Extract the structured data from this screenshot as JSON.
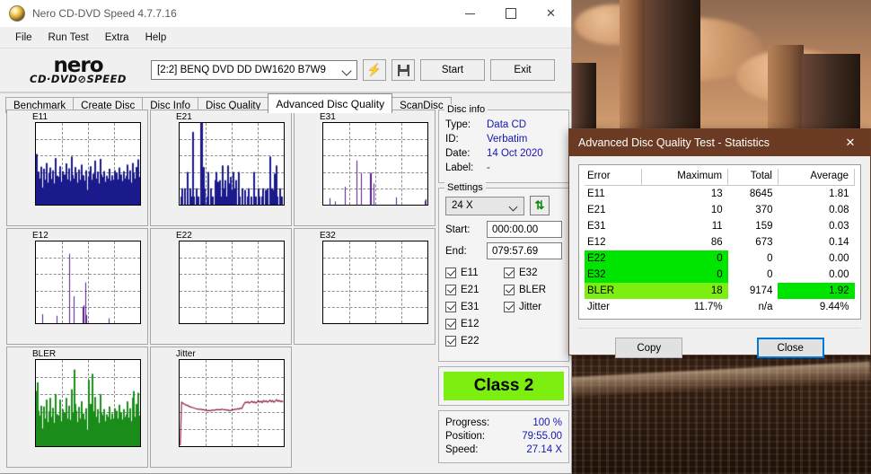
{
  "window": {
    "title": "Nero CD-DVD Speed 4.7.7.16",
    "minimize": "─",
    "maximize": "☐",
    "close": "✕"
  },
  "menu": [
    "File",
    "Run Test",
    "Extra",
    "Help"
  ],
  "toolbar": {
    "logo_line1": "nero",
    "logo_line2": "CD·DVD⊘SPEED",
    "drive": "[2:2]   BENQ DVD DD DW1620 B7W9",
    "bolt_icon": "lightning-icon",
    "save_icon": "floppy-save-icon",
    "start_label": "Start",
    "exit_label": "Exit"
  },
  "tabs": [
    {
      "label": "Benchmark",
      "active": false
    },
    {
      "label": "Create Disc",
      "active": false
    },
    {
      "label": "Disc Info",
      "active": false
    },
    {
      "label": "Disc Quality",
      "active": false
    },
    {
      "label": "Advanced Disc Quality",
      "active": true
    },
    {
      "label": "ScanDisc",
      "active": false
    }
  ],
  "disc_info": {
    "legend": "Disc info",
    "rows": [
      {
        "key": "Type:",
        "value": "Data CD"
      },
      {
        "key": "ID:",
        "value": "Verbatim"
      },
      {
        "key": "Date:",
        "value": "14 Oct 2020"
      },
      {
        "key": "Label:",
        "value": "-"
      }
    ]
  },
  "settings": {
    "legend": "Settings",
    "speed": "24 X",
    "refresh_icon": "refresh-icon",
    "start_label": "Start:",
    "start_value": "000:00.00",
    "end_label": "End:",
    "end_value": "079:57.69",
    "checkboxes_left": [
      {
        "label": "E11",
        "checked": true
      },
      {
        "label": "E21",
        "checked": true
      },
      {
        "label": "E31",
        "checked": true
      },
      {
        "label": "E12",
        "checked": true
      },
      {
        "label": "E22",
        "checked": true
      }
    ],
    "checkboxes_right": [
      {
        "label": "E32",
        "checked": true
      },
      {
        "label": "BLER",
        "checked": true
      },
      {
        "label": "Jitter",
        "checked": true
      }
    ]
  },
  "class_box": {
    "label": "Class 2",
    "color": "#7CEE10"
  },
  "progress_panel": [
    {
      "key": "Progress:",
      "value": "100 %"
    },
    {
      "key": "Position:",
      "value": "79:55.00"
    },
    {
      "key": "Speed:",
      "value": "27.14 X"
    }
  ],
  "statistics_dialog": {
    "title": "Advanced Disc Quality Test - Statistics",
    "close_icon": "✕",
    "headers": [
      "Error",
      "Maximum",
      "Total",
      "Average"
    ],
    "rows": [
      {
        "error": "E11",
        "maximum": "13",
        "total": "8645",
        "average": "1.81",
        "hl": "none"
      },
      {
        "error": "E21",
        "maximum": "10",
        "total": "370",
        "average": "0.08",
        "hl": "none"
      },
      {
        "error": "E31",
        "maximum": "11",
        "total": "159",
        "average": "0.03",
        "hl": "none"
      },
      {
        "error": "E12",
        "maximum": "86",
        "total": "673",
        "average": "0.14",
        "hl": "none"
      },
      {
        "error": "E22",
        "maximum": "0",
        "total": "0",
        "average": "0.00",
        "hl": "green"
      },
      {
        "error": "E32",
        "maximum": "0",
        "total": "0",
        "average": "0.00",
        "hl": "green"
      },
      {
        "error": "BLER",
        "maximum": "18",
        "total": "9174",
        "average": "1.92",
        "hl": "bler"
      },
      {
        "error": "Jitter",
        "maximum": "11.7%",
        "total": "n/a",
        "average": "9.44%",
        "hl": "none"
      }
    ],
    "copy_label": "Copy",
    "close_label": "Close",
    "title_bar_color": "#6b3a23",
    "green": "#00E500",
    "bler_green": "#7CEE10"
  },
  "chart_data": [
    {
      "type": "bar",
      "title": "E11",
      "xlabel": "",
      "ylabel": "",
      "xlim": [
        0,
        80
      ],
      "ylim": [
        0,
        20
      ],
      "xticks": [
        0,
        20,
        40,
        60,
        80
      ],
      "yticks": [
        4,
        8,
        12,
        16,
        20
      ],
      "color": "#1a1a8c",
      "grid": true,
      "fill": true,
      "values": [
        12.4,
        7.2,
        8.1,
        6.4,
        9.3,
        4.2,
        8.8,
        6.1,
        10.2,
        5.4,
        7.8,
        9.1,
        6.3,
        8.4,
        5.2,
        11.4,
        7.1,
        6.8,
        9.4,
        5.6,
        8.2,
        6.9,
        7.4,
        10.1,
        6.2,
        8.9,
        5.8,
        11.8,
        7.3,
        6.4,
        9.2,
        7.8,
        5.4,
        8.6,
        6.1,
        9.8,
        7.2,
        5.9,
        8.4,
        3.6,
        6.8,
        8.2,
        9.4,
        6.1,
        7.6,
        10.8,
        6.4,
        8.1,
        5.2,
        11.2,
        7.4,
        6.8,
        8.2,
        5.6,
        7.1,
        6.4,
        8.8,
        5.9,
        7.2,
        6.1,
        8.4,
        5.4,
        7.8,
        6.2,
        9.1,
        7.4,
        5.8,
        8.2,
        6.4,
        7.1,
        9.8,
        6.2,
        8.4,
        5.4,
        10.2,
        7.8,
        6.4,
        9.2,
        11.1,
        6.8
      ]
    },
    {
      "type": "bar",
      "title": "E21",
      "xlabel": "",
      "ylabel": "",
      "xlim": [
        0,
        80
      ],
      "ylim": [
        0,
        10
      ],
      "xticks": [
        0,
        20,
        40,
        60,
        80
      ],
      "yticks": [
        2,
        4,
        6,
        8,
        10
      ],
      "color": "#1a1a8c",
      "grid": true,
      "fill": true,
      "values": [
        0,
        1,
        2,
        0,
        2,
        0,
        4,
        0,
        2,
        1,
        8.9,
        1,
        0,
        2,
        1,
        0,
        10,
        10,
        4.6,
        2,
        0,
        1,
        4,
        0,
        2,
        1,
        0,
        3,
        4,
        2.8,
        0,
        3,
        1,
        4.8,
        2,
        3,
        1,
        4.8,
        2.6,
        3.4,
        1.8,
        4,
        2,
        3,
        0,
        4,
        1,
        0,
        2,
        0,
        1.8,
        0,
        1,
        2,
        0,
        1,
        0,
        4,
        1,
        0,
        2,
        1,
        0,
        1,
        2,
        0,
        1.8,
        2,
        0,
        5.9,
        1,
        2,
        1.8,
        3.8,
        4.8,
        1,
        0,
        2,
        1,
        0
      ]
    },
    {
      "type": "bar",
      "title": "E31",
      "xlabel": "",
      "ylabel": "",
      "xlim": [
        0,
        80
      ],
      "ylim": [
        0,
        20
      ],
      "xticks": [
        0,
        20,
        40,
        60,
        80
      ],
      "yticks": [
        4,
        8,
        12,
        16,
        20
      ],
      "color": "#5a1a8c",
      "grid": true,
      "fill": false,
      "values": [
        0,
        0,
        0,
        0,
        0,
        1.6,
        0,
        0,
        0,
        0.8,
        0,
        0,
        0,
        0,
        0,
        0,
        0,
        4.4,
        0,
        0,
        0,
        0,
        0,
        0,
        0,
        0,
        10.8,
        0,
        0,
        7.8,
        0,
        0,
        0,
        0,
        0,
        0,
        7.8,
        7.8,
        0,
        5.2,
        0,
        0,
        0,
        0,
        0,
        0,
        0,
        0,
        0,
        0,
        0,
        0,
        0,
        0,
        0,
        0,
        1.8,
        0,
        0,
        0,
        0,
        0,
        0,
        0,
        0,
        0,
        0,
        0,
        0,
        0,
        0,
        0,
        0,
        0,
        0,
        0,
        0,
        0,
        1,
        1.4
      ]
    },
    {
      "type": "bar",
      "title": "E12",
      "xlabel": "",
      "ylabel": "",
      "xlim": [
        0,
        80
      ],
      "ylim": [
        0,
        100
      ],
      "xticks": [
        0,
        20,
        40,
        60,
        80
      ],
      "yticks": [
        20,
        40,
        60,
        80,
        100
      ],
      "color": "#5a1a8c",
      "grid": true,
      "fill": false,
      "values": [
        0,
        0,
        0,
        0,
        0,
        11,
        0,
        0,
        0,
        0,
        0,
        0,
        0,
        0,
        0,
        0,
        9,
        0,
        0,
        0,
        0,
        0,
        0,
        0,
        0,
        0,
        85,
        0,
        0,
        33,
        0,
        0,
        0,
        0,
        0,
        0,
        20,
        22,
        50,
        10,
        0,
        0,
        0,
        0,
        0,
        0,
        0,
        0,
        0,
        0,
        0,
        0,
        0,
        0,
        0,
        0,
        6,
        0,
        0,
        0,
        0,
        0,
        0,
        0,
        0,
        0,
        0,
        0,
        0,
        0,
        0,
        0,
        0,
        0,
        0,
        0,
        0,
        0,
        0,
        0
      ]
    },
    {
      "type": "bar",
      "title": "E22",
      "xlabel": "",
      "ylabel": "",
      "xlim": [
        0,
        80
      ],
      "ylim": [
        0,
        10
      ],
      "xticks": [
        0,
        20,
        40,
        60,
        80
      ],
      "yticks": [
        2,
        4,
        6,
        8,
        10
      ],
      "color": "#5a1a8c",
      "grid": true,
      "fill": false,
      "values": []
    },
    {
      "type": "bar",
      "title": "E32",
      "xlabel": "",
      "ylabel": "",
      "xlim": [
        0,
        80
      ],
      "ylim": [
        0,
        10
      ],
      "xticks": [
        0,
        20,
        40,
        60,
        80
      ],
      "yticks": [
        2,
        4,
        6,
        8,
        10
      ],
      "color": "#5a1a8c",
      "grid": true,
      "fill": false,
      "values": []
    },
    {
      "type": "bar",
      "title": "BLER",
      "xlabel": "",
      "ylabel": "",
      "xlim": [
        0,
        80
      ],
      "ylim": [
        0,
        20
      ],
      "xticks": [
        0,
        20,
        40,
        60,
        80
      ],
      "yticks": [
        4,
        8,
        12,
        16,
        20
      ],
      "color": "#1a8c1a",
      "grid": true,
      "fill": true,
      "values": [
        12.8,
        14.8,
        8.2,
        7.1,
        9.4,
        4.1,
        9.2,
        6.4,
        10.8,
        5.6,
        8.1,
        11.2,
        6.8,
        8.9,
        5.4,
        12.1,
        7.4,
        7.1,
        10.8,
        5.8,
        8.6,
        7.2,
        7.8,
        11.2,
        6.4,
        9.4,
        6.1,
        13.2,
        7.8,
        17.8,
        9.8,
        8.2,
        5.6,
        9.1,
        6.4,
        10.4,
        7.6,
        6.2,
        8.8,
        3.8,
        15.4,
        8.6,
        9.8,
        16.8,
        8.1,
        11.4,
        6.8,
        8.6,
        5.4,
        12.1,
        7.8,
        7.2,
        8.6,
        5.8,
        7.4,
        6.8,
        9.2,
        6.2,
        7.6,
        6.4,
        8.8,
        5.8,
        8.2,
        6.4,
        9.6,
        7.8,
        6.2,
        8.6,
        6.8,
        7.4,
        10.4,
        6.6,
        8.8,
        5.8,
        11.2,
        12.8,
        6.8,
        9.8,
        12.4,
        7.1
      ]
    },
    {
      "type": "line",
      "title": "Jitter",
      "xlabel": "",
      "ylabel": "",
      "xlim": [
        0,
        80
      ],
      "ylim": [
        0,
        20
      ],
      "xticks": [
        0,
        20,
        40,
        60,
        80
      ],
      "yticks": [
        4,
        8,
        12,
        16,
        20
      ],
      "color": "#8c1a4a",
      "grid": true,
      "fill": false,
      "values": [
        0.2,
        10.2,
        10.0,
        9.8,
        9.6,
        9.5,
        9.4,
        9.2,
        9.1,
        9.0,
        8.9,
        8.8,
        8.7,
        8.6,
        8.6,
        8.5,
        8.6,
        8.4,
        8.5,
        8.3,
        8.4,
        8.2,
        8.3,
        8.2,
        8.3,
        8.4,
        8.3,
        8.4,
        8.5,
        8.4,
        8.5,
        8.4,
        8.6,
        8.5,
        8.4,
        8.5,
        8.3,
        8.4,
        8.2,
        8.3,
        8.5,
        8.4,
        8.6,
        8.5,
        8.7,
        8.6,
        8.8,
        8.7,
        9.2,
        9.8,
        10.2,
        10.1,
        10.3,
        10.0,
        10.2,
        10.4,
        10.1,
        10.3,
        10.0,
        10.2,
        10.5,
        10.2,
        10.4,
        10.1,
        10.6,
        10.3,
        10.5,
        10.2,
        10.4,
        10.7,
        10.3,
        10.6,
        10.2,
        10.5,
        10.8,
        10.4,
        10.6,
        10.3,
        10.5,
        10.2
      ]
    }
  ]
}
